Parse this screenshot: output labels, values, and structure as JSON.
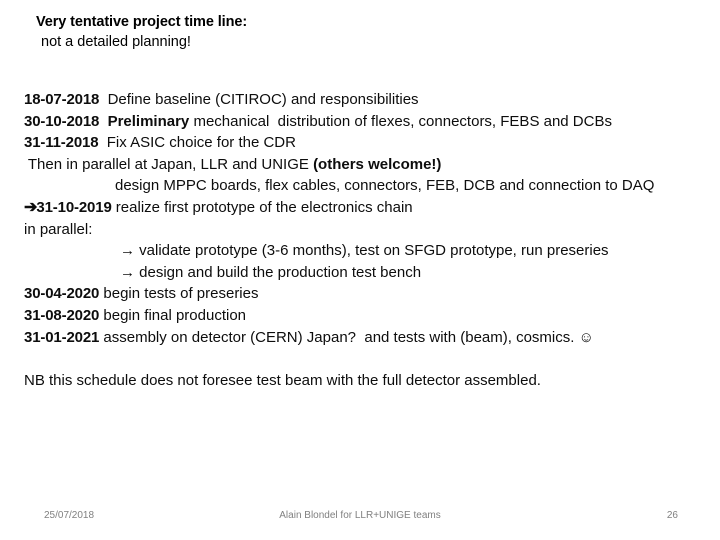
{
  "slide": {
    "title": {
      "line1": "Very tentative project time line:",
      "line2": "not a detailed planning!"
    },
    "body_lines": [
      {
        "date": "18-07-2018",
        "text": "  Define baseline (CITIROC) and responsibilities"
      },
      {
        "date": "30-10-2018",
        "bold_word": "  Preliminary",
        "text": " mechanical  distribution of flexes, connectors, FEBS and DCBs"
      },
      {
        "date": "31-11-2018",
        "text": "  Fix ASIC choice for the CDR"
      },
      {
        "text": " Then in parallel at Japan, LLR and UNIGE ",
        "bold_tail": "(others welcome!)"
      },
      {
        "text": "design MPPC boards, flex cables, connectors, FEB, DCB and connection to DAQ"
      },
      {
        "arrow": "➔",
        "date": "31-10-2019",
        "text": " realize first prototype of the electronics chain"
      },
      {
        "text": "in parallel:"
      },
      {
        "arrow": "→",
        "text": " validate prototype (3-6 months), test on SFGD prototype, run preseries"
      },
      {
        "arrow": "→",
        "text": " design and build the production test bench"
      },
      {
        "date": "30-04-2020",
        "text": " begin tests of preseries"
      },
      {
        "date": "31-08-2020",
        "text": " begin final production"
      },
      {
        "date": "31-01-2021",
        "text": " assembly on detector (CERN) Japan?  and tests with (beam), cosmics. ",
        "smiley": "☺"
      }
    ],
    "note": "NB this schedule does not foresee test beam with the full detector assembled.",
    "footer": {
      "date": "25/07/2018",
      "center": "Alain Blondel for LLR+UNIGE teams",
      "page_number": "26"
    },
    "colors": {
      "text": "#0d0d0d",
      "footer_text": "#808080",
      "background": "#ffffff"
    }
  }
}
